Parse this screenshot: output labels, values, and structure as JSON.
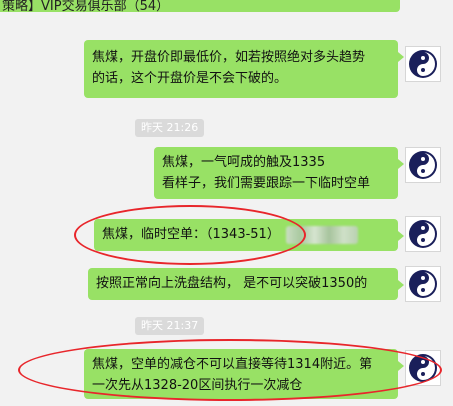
{
  "header": {
    "title_partial": "策略】VIP交易俱乐部（54）"
  },
  "messages": [
    {
      "lines": [
        "焦煤，开盘价即最低价，如若按照绝对多头趋势",
        "的话，这个开盘价是不会下破的。"
      ]
    },
    {
      "lines": [
        "焦煤，一气呵成的触及1335",
        "看样子，我们需要跟踪一下临时空单"
      ]
    },
    {
      "lines": [
        "焦煤，临时空单：（1343-51）"
      ]
    },
    {
      "lines": [
        "按照正常向上洗盘结构，  是不可以突破1350的"
      ]
    },
    {
      "lines": [
        "焦煤，空单的减仓不可以直接等待1314附近。第",
        "一次先从1328-20区间执行一次减仓"
      ]
    }
  ],
  "timestamps": [
    "昨天 21:26",
    "昨天 21:37"
  ],
  "colors": {
    "bubble": "#98e165",
    "highlight": "#e8262b",
    "background": "#f2f2f2"
  },
  "icons": {
    "avatar": "yin-yang-icon"
  }
}
